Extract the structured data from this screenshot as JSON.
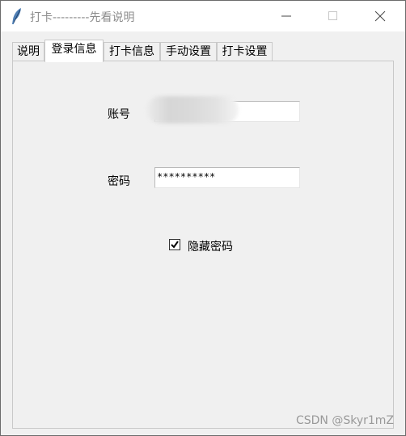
{
  "window": {
    "title": "打卡---------先看说明"
  },
  "tabs": [
    {
      "label": "说明"
    },
    {
      "label": "登录信息",
      "selected": true
    },
    {
      "label": "打卡信息"
    },
    {
      "label": "手动设置"
    },
    {
      "label": "打卡设置"
    }
  ],
  "form": {
    "account_label": "账号",
    "account_value": "",
    "password_label": "密码",
    "password_value": "**********",
    "hide_password_label": "隐藏密码",
    "hide_password_checked": true
  },
  "watermark": "CSDN @Skyr1mZ"
}
